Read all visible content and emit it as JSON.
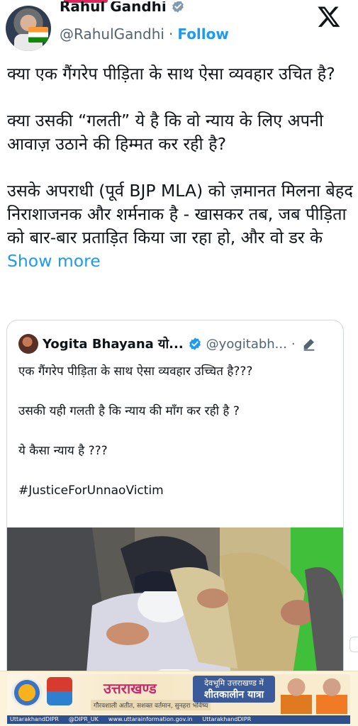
{
  "header": {
    "name": "Rahul Gandhi",
    "handle": "@RahulGandhi",
    "separator": "·",
    "follow_label": "Follow"
  },
  "tweet": {
    "paragraphs": [
      "क्या एक गैंगरेप पीड़िता के साथ ऐसा व्यवहार उचित है?",
      "क्या उसकी “गलती” ये है कि वो न्याय के लिए अपनी आवाज़ उठाने की हिम्मत कर रही है?",
      "उसके अपराधी (पूर्व BJP MLA) को ज़मानत मिलना बेहद निराशाजनक और शर्मनाक है - खासकर तब, जब पीड़िता को बार-बार प्रताड़ित किया जा रहा हो, और वो डर के"
    ],
    "show_more": "Show more"
  },
  "quote": {
    "name": "Yogita Bhayana यो...",
    "handle": "@yogitabh...",
    "separator": "·",
    "lines": [
      "एक गैंगरेप पीड़िता के साथ ऐसा व्यवहार उच्चित है???",
      "उसकी यही गलती है कि न्याय की माँग कर रही है ?",
      "ये कैसा न्याय है ???",
      "#JusticeForUnnaoVictim"
    ]
  },
  "banner": {
    "brand": "उत्तराखण्ड",
    "tagline": "गौरवशाली अतीत, सशक्त वर्तमान, सुनहरा भविष्य",
    "badge_line1": "देवभूमि उत्तराखण्ड में",
    "badge_line2": "शीतकालीन यात्रा",
    "footer_items": [
      "UttarakhandDIPR",
      "@DIPR_UK",
      "www.uttarainformation.gov.in",
      "UttarakhandDIPR"
    ]
  },
  "colors": {
    "link_blue": "#1d9bf0",
    "text": "#0f1419",
    "muted": "#536471",
    "accent_pink": "#e0245e"
  }
}
